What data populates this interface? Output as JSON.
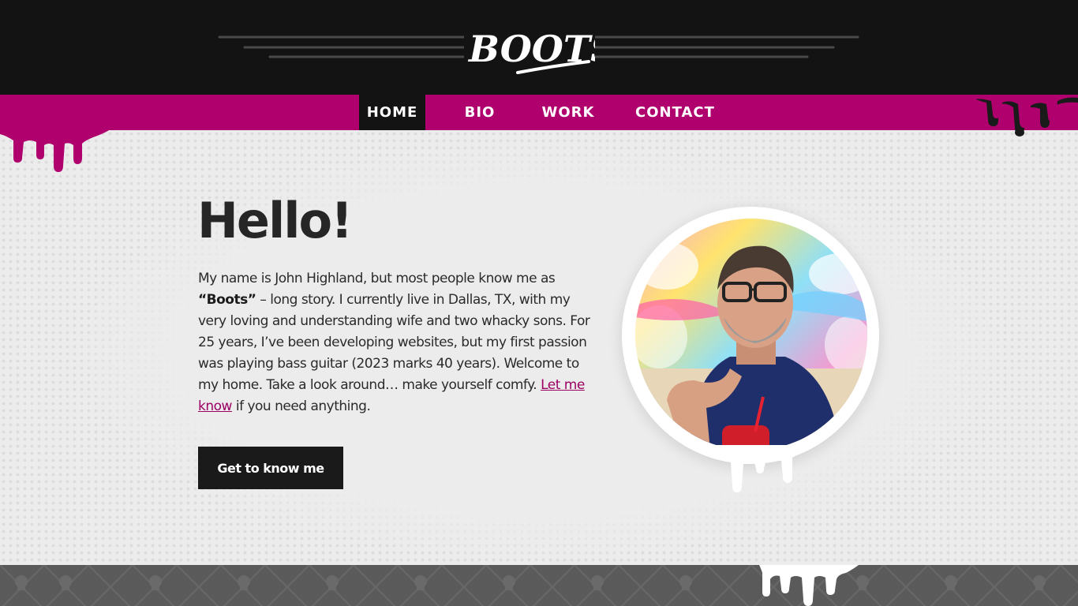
{
  "site": {
    "logo_text": "BOOTS"
  },
  "nav": {
    "items": [
      {
        "label": "HOME",
        "active": true
      },
      {
        "label": "BIO",
        "active": false
      },
      {
        "label": "WORK",
        "active": false
      },
      {
        "label": "CONTACT",
        "active": false
      }
    ]
  },
  "hero": {
    "heading": "Hello!",
    "intro": {
      "part1": "My name is John Highland, but most people know me as ",
      "nickname": "“Boots”",
      "part2": " – long story. I currently live in Dallas, TX, with my very loving and understanding wife and two whacky sons. For 25 years, I’ve been developing websites, but my first passion was playing bass guitar (2023 marks 40 years). Welcome to my home. Take a look around… make yourself comfy. ",
      "link_label": "Let me know",
      "part3": " if you need anything."
    },
    "cta_label": "Get to know me"
  },
  "colors": {
    "header_bg": "#131313",
    "accent_magenta": "#b0006e",
    "link": "#9b0062",
    "page_bg": "#ececec",
    "button_bg": "#1a1a1a",
    "footer_bg": "#5a5a5a"
  },
  "icons": {
    "portrait": "portrait-photo",
    "footer_pattern": "skull-icon"
  }
}
